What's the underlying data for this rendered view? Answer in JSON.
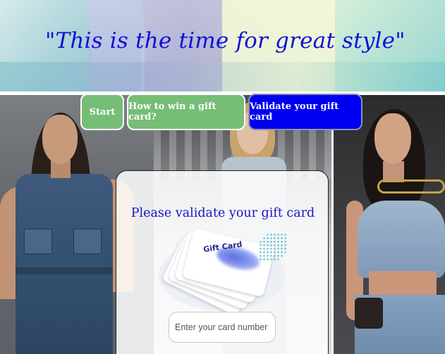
{
  "header": {
    "tagline": "\"This is the time for great style\""
  },
  "nav": {
    "start_label": "Start",
    "how_label": "How to win a gift card?",
    "validate_label": "Validate your gift card"
  },
  "card": {
    "title": "Please validate your gift card",
    "gift_card_text": "Gift Card",
    "input_placeholder": "Enter your card number"
  },
  "colors": {
    "nav_green": "#76bd76",
    "nav_active_blue": "#0000f0",
    "title_blue": "#1616c8"
  },
  "icons": {
    "gift_card": "gift-card-stack-icon"
  }
}
